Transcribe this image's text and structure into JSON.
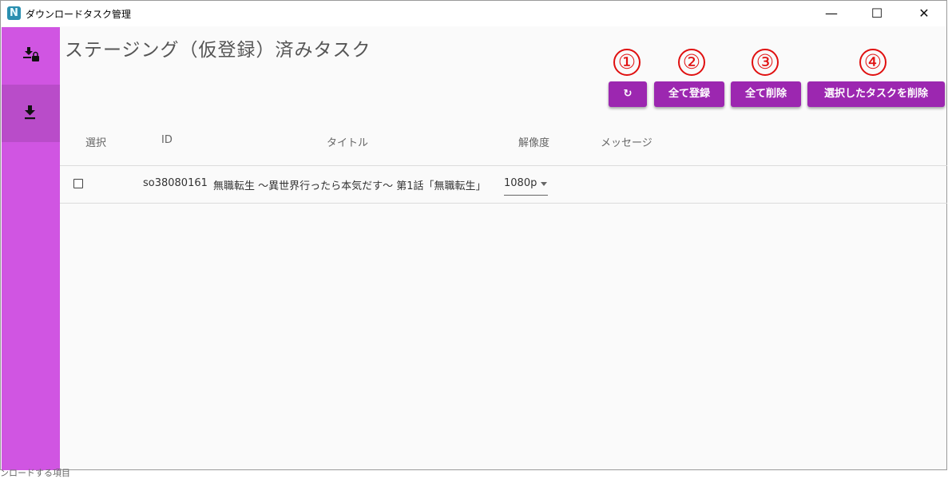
{
  "window": {
    "title": "ダウンロードタスク管理",
    "app_icon_letter": "N",
    "controls": {
      "minimize": "—",
      "maximize": "☐",
      "close": "✕"
    }
  },
  "sidebar": {
    "items": [
      {
        "icon": "download-lock-icon",
        "active": false
      },
      {
        "icon": "download-icon",
        "active": true
      }
    ]
  },
  "page": {
    "title": "ステージング（仮登録）済みタスク"
  },
  "toolbar": {
    "refresh_icon": "↻",
    "register_all_label": "全て登録",
    "delete_all_label": "全て削除",
    "delete_selected_label": "選択したタスクを削除",
    "markers": [
      "①",
      "②",
      "③",
      "④"
    ],
    "colors": {
      "button": "#9c27b0",
      "marker": "#e01010"
    }
  },
  "table": {
    "columns": [
      "選択",
      "ID",
      "タイトル",
      "解像度",
      "メッセージ"
    ],
    "rows": [
      {
        "selected": false,
        "id": "so38080161",
        "title": "無職転生 〜異世界行ったら本気だす〜 第1話「無職転生」",
        "resolution": "1080p",
        "message": ""
      }
    ]
  },
  "stray_text": "ンロードする項目"
}
